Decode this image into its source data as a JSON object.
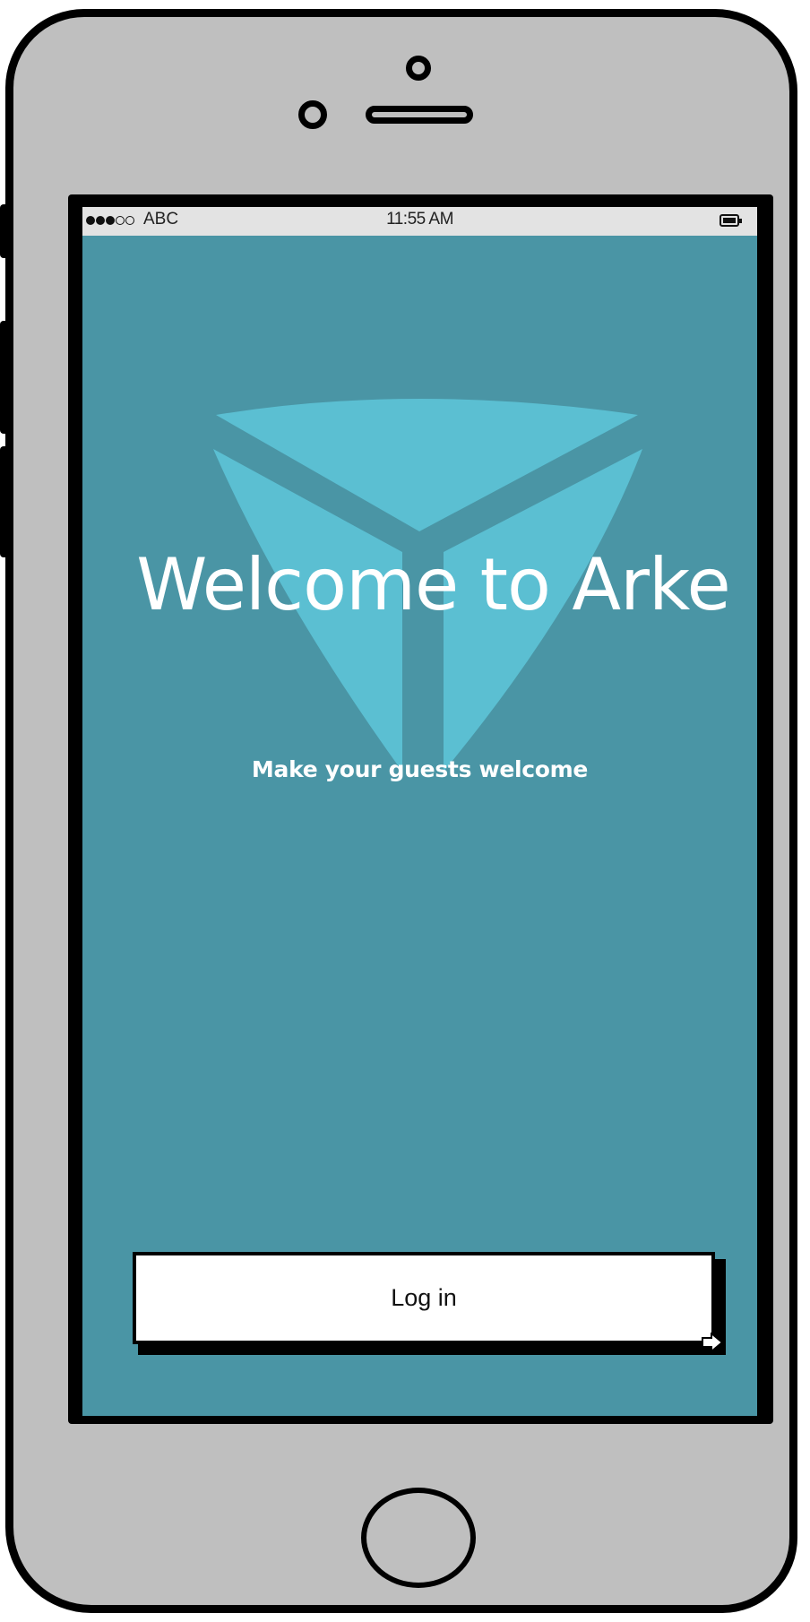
{
  "status_bar": {
    "carrier": "ABC",
    "time": "11:55 AM",
    "signal_bars_filled": 3,
    "signal_bars_total": 5
  },
  "splash": {
    "title": "Welcome to Arke",
    "subtitle": "Make your guests welcome"
  },
  "login_button": {
    "label": "Log in"
  },
  "icons": {
    "logo": "arke-logo-icon",
    "battery": "battery-icon",
    "cursor": "pointer-cursor-icon"
  },
  "colors": {
    "phone_body": "#bfbfbf",
    "screen_background": "#4a95a5",
    "logo": "#5bbfd2",
    "text": "#ffffff",
    "status_bar": "#e3e3e3"
  }
}
